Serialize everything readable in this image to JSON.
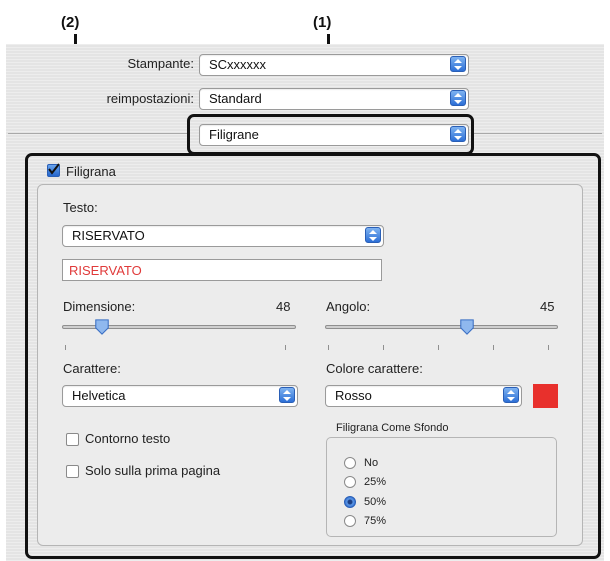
{
  "callouts": {
    "left": "(2)",
    "right": "(1)"
  },
  "printer": {
    "label": "Stampante:",
    "value": "SCxxxxxx"
  },
  "presets": {
    "label": "reimpostazioni:",
    "value": "Standard"
  },
  "panel_selector": {
    "value": "Filigrane"
  },
  "watermark": {
    "checkbox_label": "Filigrana",
    "checked": true,
    "text_label": "Testo:",
    "text_popup_value": "RISERVATO",
    "text_field_value": "RISERVATO",
    "size_label": "Dimensione:",
    "size_value": "48",
    "angle_label": "Angolo:",
    "angle_value": "45",
    "font_label": "Carattere:",
    "font_value": "Helvetica",
    "color_label": "Colore carattere:",
    "color_value": "Rosso",
    "color_swatch": "#e8302c",
    "outline_label": "Contorno testo",
    "outline_checked": false,
    "first_page_label": "Solo sulla prima pagina",
    "first_page_checked": false,
    "background_group_title": "Filigrana Come Sfondo",
    "background_options": [
      "No",
      "25%",
      "50%",
      "75%"
    ],
    "background_selected": "50%"
  },
  "colors": {
    "accent_blue": "#2c6fd6",
    "text_red": "#e03a3a"
  }
}
